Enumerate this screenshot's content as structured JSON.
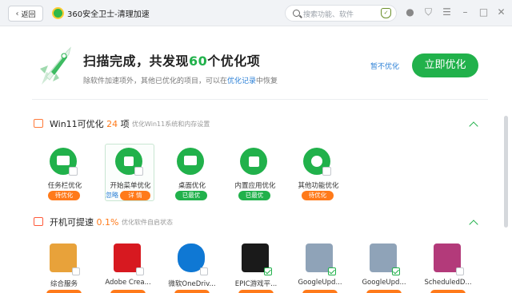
{
  "topbar": {
    "back_label": "返回",
    "title": "360安全卫士-清理加速",
    "search_placeholder": "搜索功能、软件"
  },
  "header": {
    "title_prefix": "扫描完成，共发现",
    "title_count": "60",
    "title_suffix": "个优化项",
    "subtitle_prefix": "除软件加速项外，其他已优化的项目，可以在",
    "subtitle_link": "优化记录",
    "subtitle_suffix": "中恢复",
    "ignore_link": "暂不优化",
    "optimize_button": "立即优化"
  },
  "win11_section": {
    "title": "Win11可优化",
    "count": "24",
    "unit": "项",
    "subtitle": "优化Win11系统和内存设置",
    "items": [
      {
        "label": "任务栏优化",
        "status": "待优化",
        "status_color": "orange",
        "icon": "taskbar-icon"
      },
      {
        "label": "开始菜单优化",
        "status": "详 情",
        "ignore": "忽略",
        "status_color": "orange",
        "icon": "windows-logo-icon"
      },
      {
        "label": "桌面优化",
        "status": "已最优",
        "status_color": "green",
        "icon": "desktop-icon"
      },
      {
        "label": "内置应用优化",
        "status": "已最优",
        "status_color": "green",
        "icon": "apps-grid-icon"
      },
      {
        "label": "其他功能优化",
        "status": "待优化",
        "status_color": "orange",
        "icon": "pie-chart-icon"
      }
    ]
  },
  "startup_section": {
    "title": "开机可提速",
    "percent": "0.1%",
    "subtitle": "优化软件自启状态",
    "apps": [
      {
        "label": "综合服务",
        "checked": false,
        "color": "#e8a23a",
        "icon": "service-bundle-icon"
      },
      {
        "label": "Adobe Crea...",
        "checked": false,
        "color": "#d71920",
        "icon": "adobe-cc-icon"
      },
      {
        "label": "微软OneDriv...",
        "checked": false,
        "color": "#0f78d4",
        "icon": "onedrive-cloud-icon"
      },
      {
        "label": "EPIC游戏平...",
        "checked": true,
        "color": "#1a1a1a",
        "icon": "epic-games-icon"
      },
      {
        "label": "GoogleUpd...",
        "checked": true,
        "color": "#8fa3b8",
        "icon": "google-update-icon"
      },
      {
        "label": "GoogleUpd...",
        "checked": true,
        "color": "#8fa3b8",
        "icon": "google-update-icon"
      },
      {
        "label": "ScheduledD...",
        "checked": false,
        "color": "#b33a7a",
        "icon": "scheduled-task-icon"
      }
    ]
  },
  "colors": {
    "accent": "#21b14b",
    "warning": "#ff7a1a",
    "link": "#2a7fd6"
  }
}
